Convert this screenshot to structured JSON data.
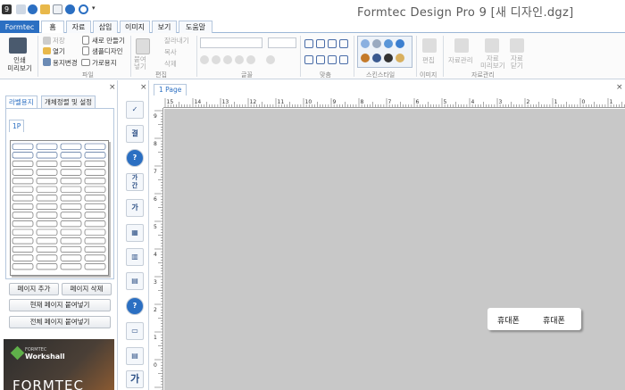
{
  "window": {
    "title": "Formtec Design Pro 9 [새 디자인.dgz]"
  },
  "menu_tabs": [
    "Formtec",
    "홈",
    "자료",
    "삽입",
    "이미지",
    "보기",
    "도움말"
  ],
  "ribbon": {
    "print_preview": "인쇄\n미리보기",
    "file": {
      "save": "저장",
      "open": "열기",
      "change_paper": "용지변경",
      "new": "새로 만들기",
      "sample": "샘플디자인",
      "landscape": "가로용지",
      "group": "파일"
    },
    "edit": {
      "paste": "붙여\n넣기",
      "cut": "잘라내기",
      "copy": "복사",
      "delete": "삭제",
      "group": "편집"
    },
    "font_group": "글꼴",
    "align_group": "맞춤",
    "style_group": "스킨스타일",
    "image": {
      "edit": "편집",
      "group": "이미지"
    },
    "data": {
      "manage": "자료관리",
      "stamp": "자료\n미리보기",
      "close": "자료\n닫기",
      "group": "자료관리"
    }
  },
  "left_panel": {
    "tabs": [
      "라벨용지",
      "개체정렬 및 설정"
    ],
    "page_tab": "1P",
    "buttons": {
      "add_page": "페이지 추가",
      "delete_page": "페이지 삭제",
      "paste_current": "현재 페이지 붙여넣기",
      "paste_all": "전체 페이지 붙여넣기"
    },
    "promo": {
      "brand": "FORMTEC",
      "product": "Workshall",
      "big": "FORMTEC"
    }
  },
  "toolbar": {
    "items": [
      "✓",
      "결",
      "?",
      "가\n간",
      "가",
      "▦",
      "▥",
      "▤",
      "?",
      "▭",
      "▤",
      "가"
    ]
  },
  "canvas": {
    "page_tab": "1 Page",
    "label": {
      "text1": "휴대폰",
      "text2": "휴대폰"
    },
    "ruler_h": [
      "15",
      "14",
      "13",
      "12",
      "11",
      "10",
      "9",
      "8",
      "7",
      "6",
      "5",
      "4",
      "3",
      "2",
      "1",
      "0",
      "1"
    ],
    "ruler_v": [
      "9",
      "8",
      "7",
      "6",
      "5",
      "4",
      "3",
      "2",
      "1",
      "0",
      "1"
    ]
  },
  "colors": {
    "accent": "#2b6fc2",
    "canvas_bg": "#c8c8c8"
  }
}
